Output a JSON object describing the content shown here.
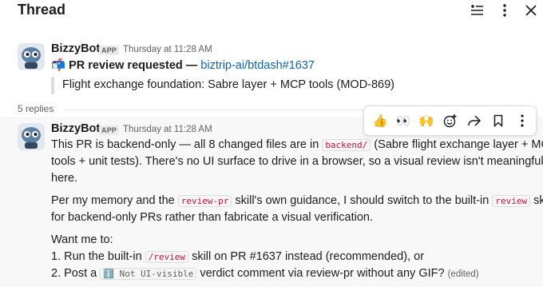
{
  "header": {
    "title": "Thread"
  },
  "message1": {
    "author": "BizzyBot",
    "badge": "APP",
    "time": "Thursday at 11:28 AM",
    "emoji": "📬",
    "headline_bold": "PR review requested —",
    "headline_link": "biztrip-ai/btdash#1637",
    "quote": "Flight exchange foundation: Sabre layer + MCP tools (MOD-869)"
  },
  "replies": {
    "label": "5 replies"
  },
  "toolbar": {
    "reaction1": "👍",
    "reaction2": "👀",
    "reaction3": "🙌"
  },
  "message2": {
    "author": "BizzyBot",
    "badge": "APP",
    "time": "Thursday at 11:28 AM",
    "p1": {
      "a": "This PR is backend-only — all 8 changed files are in ",
      "code": "backend/",
      "b": " (Sabre flight exchange layer + MCP",
      "line2": "tools + unit tests). There's no UI surface to drive in a browser, so a visual review isn't meaningful",
      "line3": "here."
    },
    "p2": {
      "a": "Per my memory and the ",
      "code1": "review-pr",
      "b": " skill's own guidance, I should switch to the built-in ",
      "code2": "review",
      "c": " skill",
      "line2": "for backend-only PRs rather than fabricate a visual verification."
    },
    "p3": {
      "intro": "Want me to:",
      "item1_a": "1. Run the built-in ",
      "item1_code": "/review",
      "item1_b": " skill on PR #1637 instead (recommended), or",
      "item2_a": "2. Post a ",
      "item2_icon": "ℹ️",
      "item2_code": "Not UI-visible",
      "item2_b": " verdict comment via review-pr without any GIF? ",
      "edited": "(edited)"
    }
  }
}
